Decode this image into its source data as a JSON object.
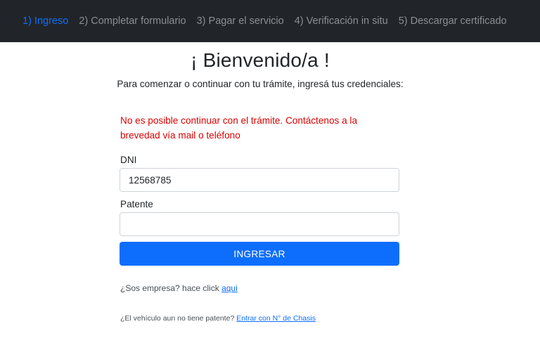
{
  "nav": {
    "steps": [
      {
        "label": "1) Ingreso",
        "active": true
      },
      {
        "label": "2) Completar formulario",
        "active": false
      },
      {
        "label": "3) Pagar el servicio",
        "active": false
      },
      {
        "label": "4) Verificación in situ",
        "active": false
      },
      {
        "label": "5) Descargar certificado",
        "active": false
      }
    ],
    "background": "#212529",
    "active_color": "#0d6efd"
  },
  "page": {
    "title": "¡ Bienvenido/a !",
    "intro": "Para comenzar o continuar con tu trámite, ingresá tus credenciales:"
  },
  "error": {
    "message": "No es posible continuar con el trámite. Contáctenos a la brevedad vía mail o teléfono",
    "color": "#dc0000"
  },
  "form": {
    "dni_label": "DNI",
    "dni_value": "12568785",
    "patente_label": "Patente",
    "patente_value": "",
    "submit_label": "INGRESAR",
    "submit_color": "#0d6efd"
  },
  "links": {
    "empresa_text": "¿Sos empresa? hace click",
    "empresa_link": "aqui",
    "chasis_text": "¿El vehículo aun no tiene patente?",
    "chasis_link": "Entrar con N° de Chasis"
  }
}
